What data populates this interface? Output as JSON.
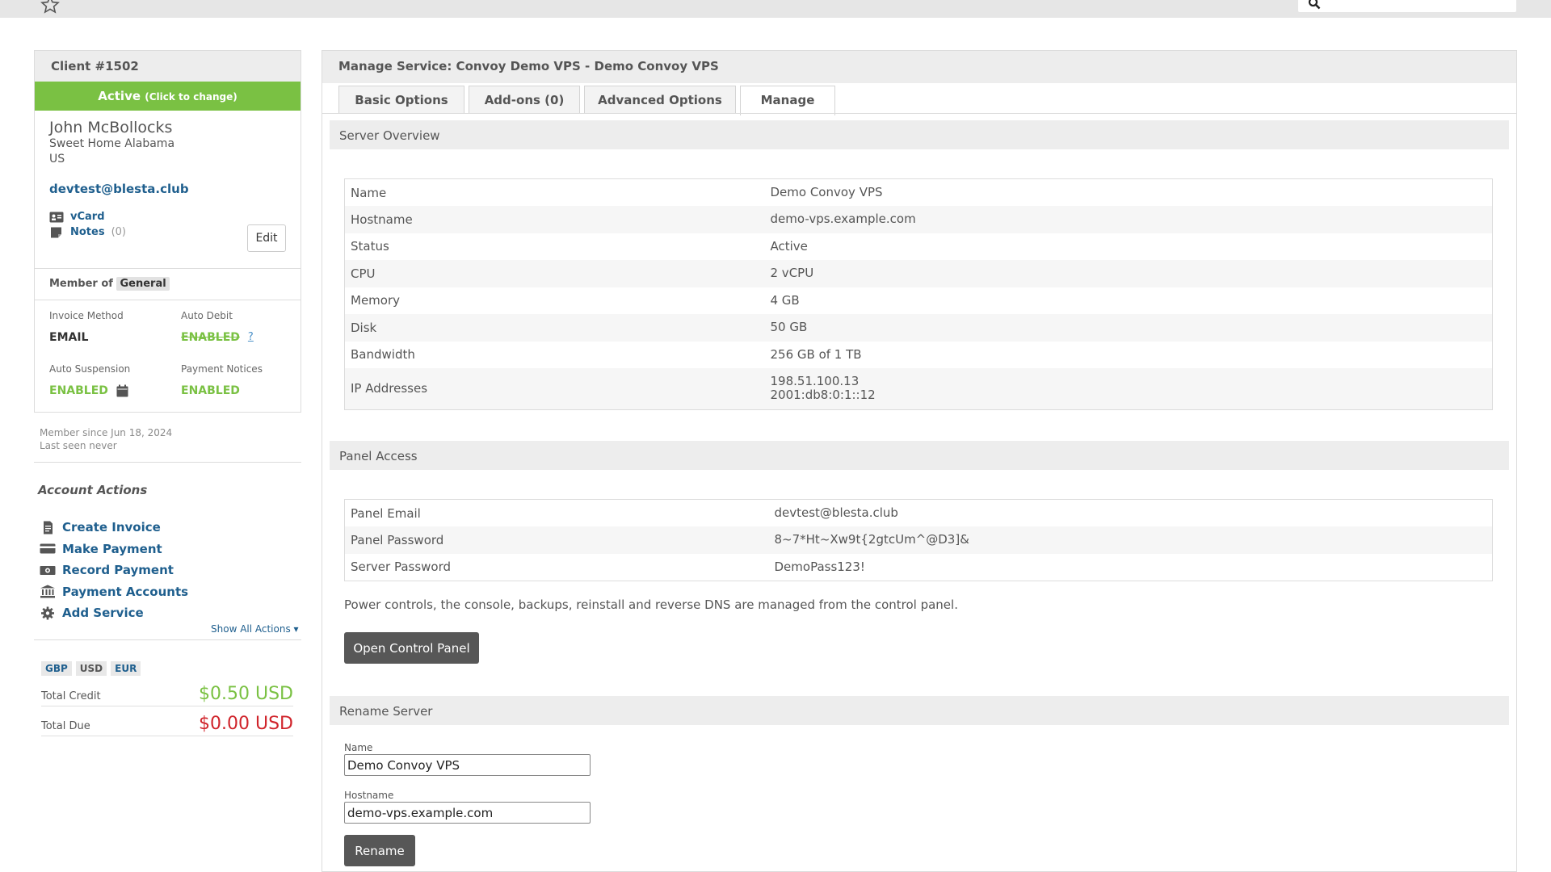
{
  "topbar": {
    "star_icon": "star-icon",
    "search_icon": "search-icon",
    "search_value": ""
  },
  "client": {
    "title": "Client #1502",
    "status": "Active",
    "status_hint": "(Click to change)",
    "name": "John McBollocks",
    "address_line": "Sweet Home Alabama",
    "country": "US",
    "email": "devtest@blesta.club",
    "vcard_label": "vCard",
    "notes_label": "Notes",
    "notes_count": "(0)",
    "edit_label": "Edit",
    "member_of_label": "Member of",
    "group": "General",
    "invoice_method_label": "Invoice Method",
    "invoice_method": "EMAIL",
    "auto_debit_label": "Auto Debit",
    "auto_debit": "ENABLED",
    "auto_debit_help": "?",
    "auto_suspension_label": "Auto Suspension",
    "auto_suspension": "ENABLED",
    "payment_notices_label": "Payment Notices",
    "payment_notices": "ENABLED",
    "member_since": "Member since Jun 18, 2024",
    "last_seen": "Last seen never"
  },
  "account_actions": {
    "title": "Account Actions",
    "items": [
      {
        "label": "Create Invoice",
        "icon": "invoice-icon"
      },
      {
        "label": "Make Payment",
        "icon": "credit-card-icon"
      },
      {
        "label": "Record Payment",
        "icon": "money-icon"
      },
      {
        "label": "Payment Accounts",
        "icon": "bank-icon"
      },
      {
        "label": "Add Service",
        "icon": "gear-icon"
      }
    ],
    "show_all": "Show All Actions"
  },
  "totals": {
    "currencies": [
      "GBP",
      "USD",
      "EUR"
    ],
    "total_credit_label": "Total Credit",
    "total_credit": "$0.50 USD",
    "total_due_label": "Total Due",
    "total_due": "$0.00 USD"
  },
  "colors": {
    "green": "#7ac143",
    "link": "#1f5f8e",
    "red": "#d0242b",
    "dark_button": "#575757"
  },
  "main": {
    "title": "Manage Service: Convoy Demo VPS - Demo Convoy VPS",
    "tabs": [
      "Basic Options",
      "Add-ons (0)",
      "Advanced Options",
      "Manage"
    ],
    "active_tab": "Manage",
    "server_overview": {
      "title": "Server Overview",
      "rows": [
        {
          "label": "Name",
          "value": "Demo Convoy VPS"
        },
        {
          "label": "Hostname",
          "value": "demo-vps.example.com"
        },
        {
          "label": "Status",
          "value": "Active"
        },
        {
          "label": "CPU",
          "value": "2 vCPU"
        },
        {
          "label": "Memory",
          "value": "4 GB"
        },
        {
          "label": "Disk",
          "value": "50 GB"
        },
        {
          "label": "Bandwidth",
          "value": "256 GB of 1 TB"
        }
      ],
      "ip_label": "IP Addresses",
      "ipv4": "198.51.100.13",
      "ipv6": "2001:db8:0:1::12"
    },
    "panel_access": {
      "title": "Panel Access",
      "rows": [
        {
          "label": "Panel Email",
          "value": "devtest@blesta.club"
        },
        {
          "label": "Panel Password",
          "value": "8~7*Ht~Xw9t{2gtcUm^@D3]&"
        },
        {
          "label": "Server Password",
          "value": "DemoPass123!"
        }
      ],
      "note": "Power controls, the console, backups, reinstall and reverse DNS are managed from the control panel.",
      "button": "Open Control Panel"
    },
    "rename_server": {
      "title": "Rename Server",
      "name_label": "Name",
      "name_value": "Demo Convoy VPS",
      "hostname_label": "Hostname",
      "hostname_value": "demo-vps.example.com",
      "button": "Rename"
    }
  }
}
